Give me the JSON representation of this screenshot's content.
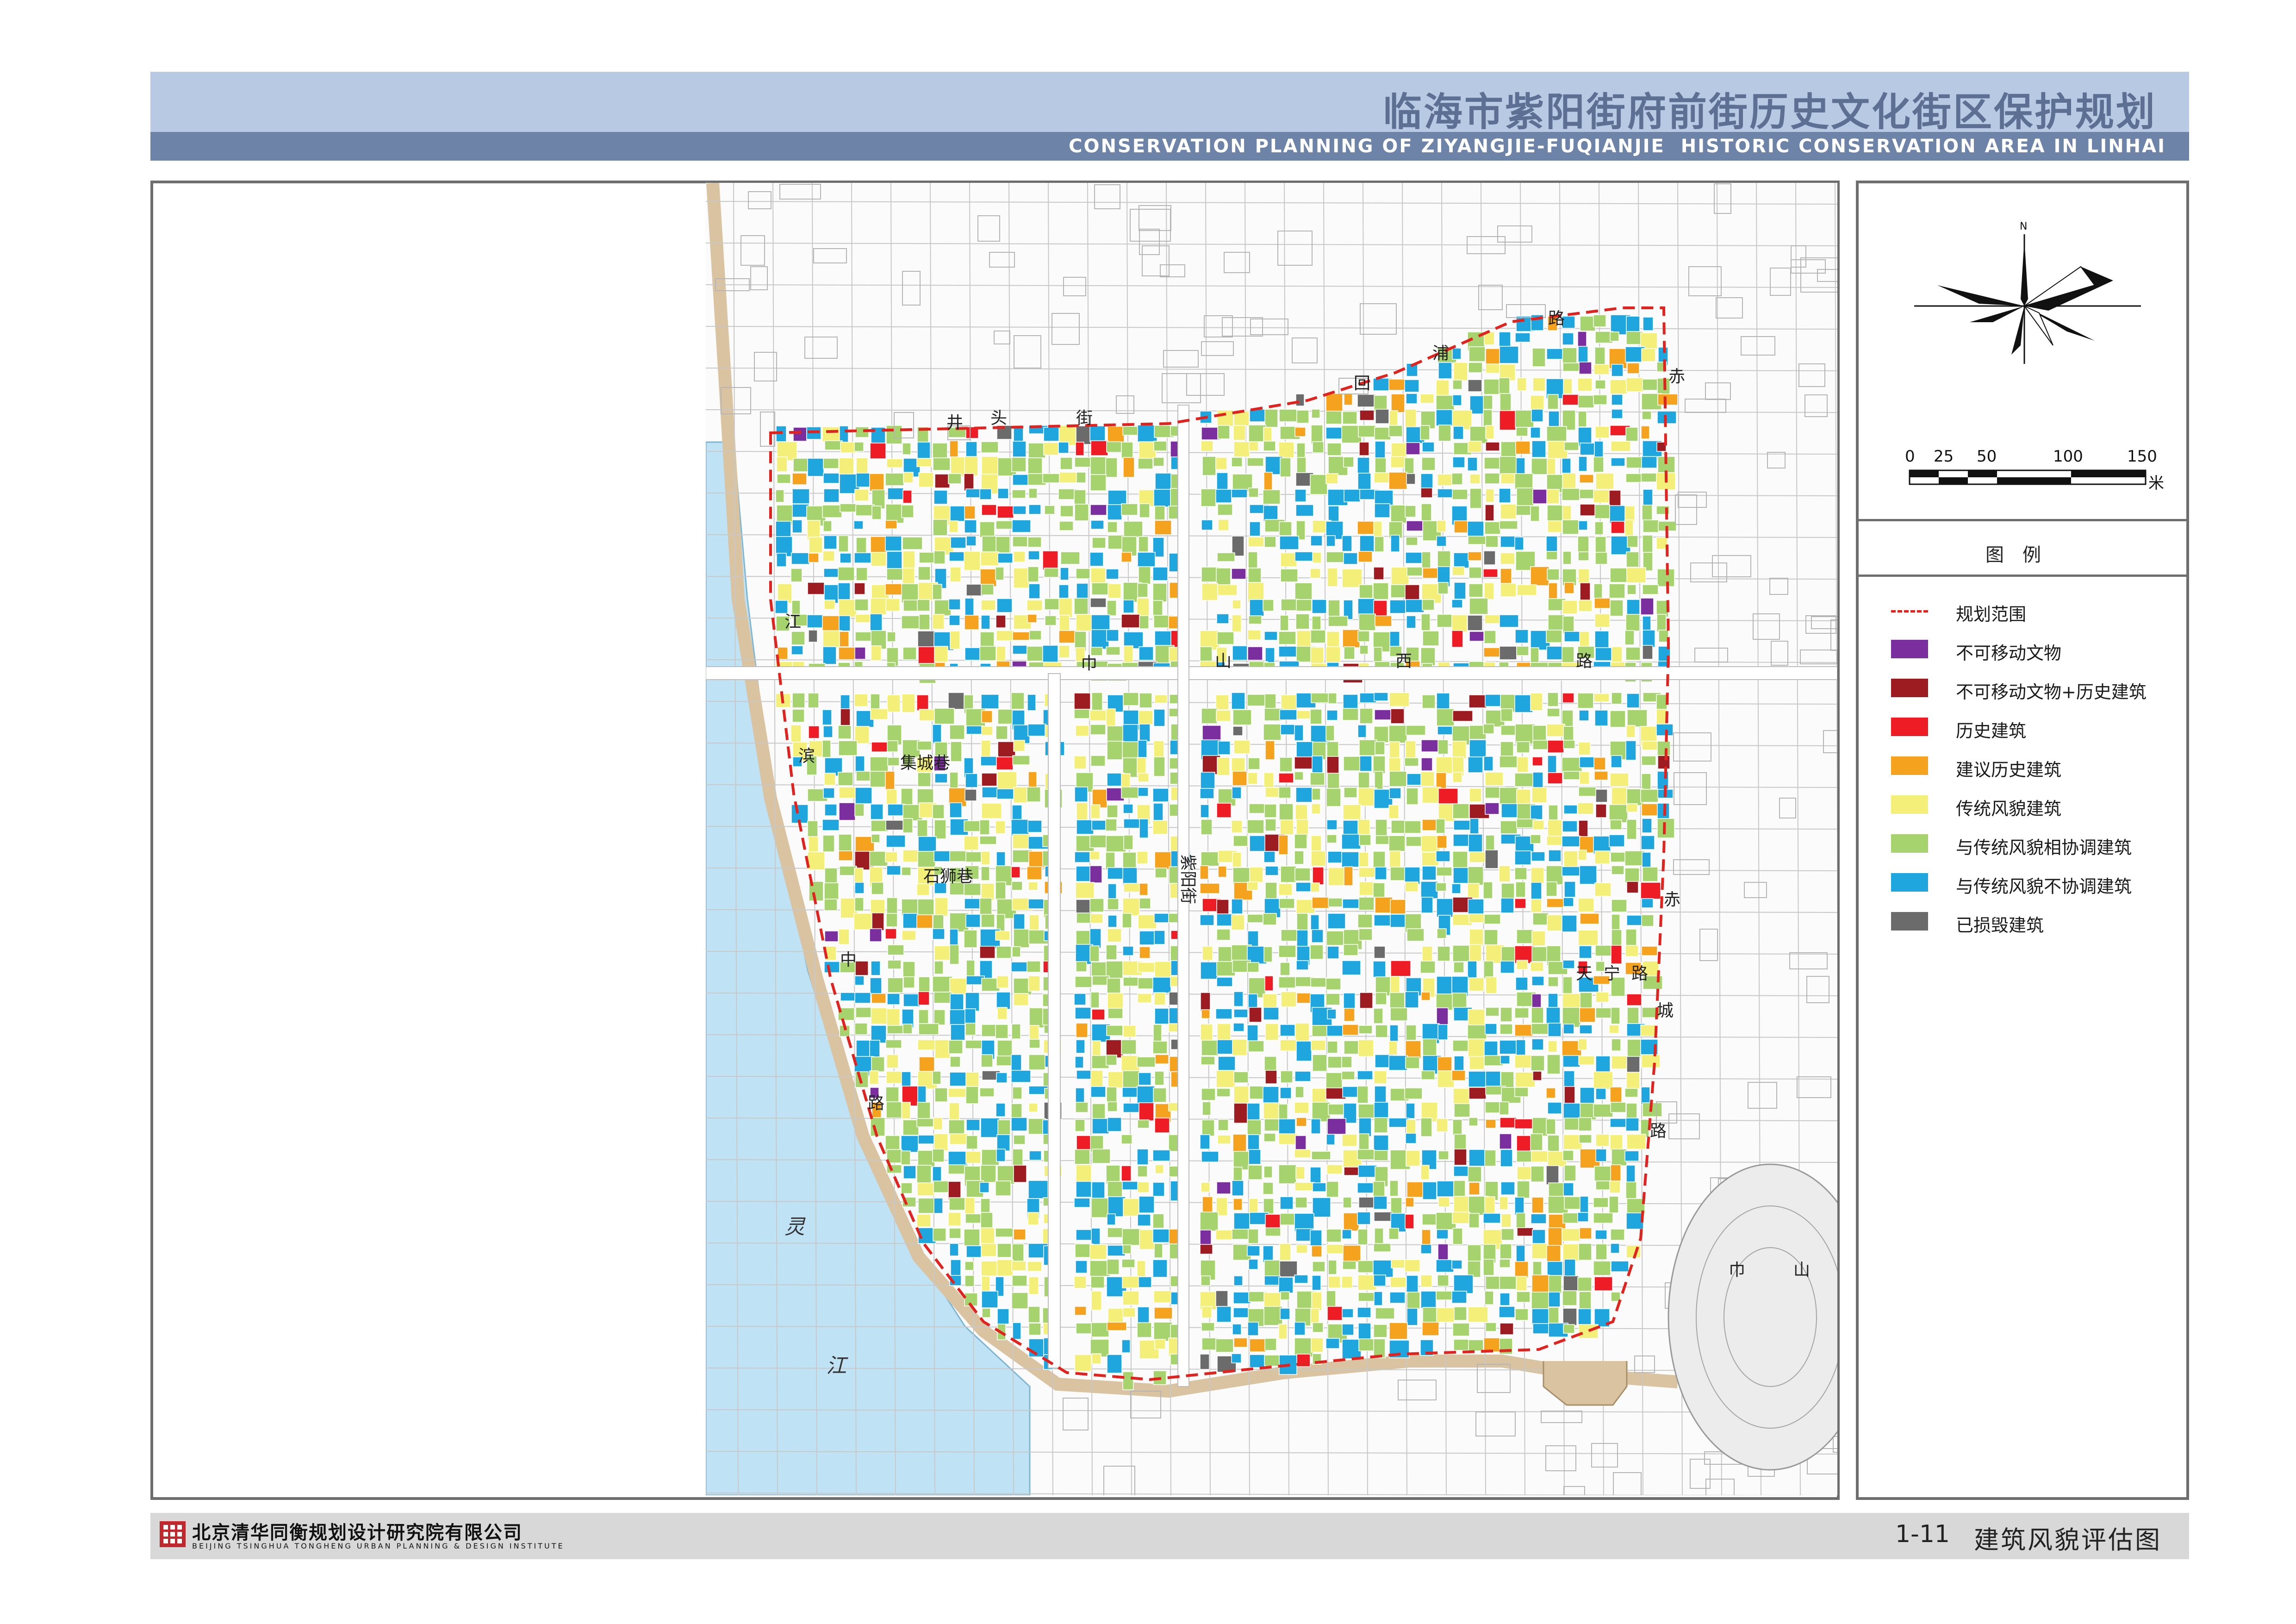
{
  "header": {
    "title": "临海市紫阳街府前街历史文化街区保护规划",
    "subtitle": "CONSERVATION PLANNING OF ZIYANGJIE-FUQIANJIE  HISTORIC CONSERVATION AREA IN LINHAI"
  },
  "scale": {
    "ticks": [
      "0",
      "25",
      "50",
      "100",
      "150"
    ],
    "unit": "米"
  },
  "compass": {
    "north_label": "N"
  },
  "legend": {
    "title": "图例",
    "items": [
      {
        "label": "规划范围",
        "color": "#e0231e",
        "style": "dashed"
      },
      {
        "label": "不可移动文物",
        "color": "#7b2e9e",
        "style": "fill"
      },
      {
        "label": "不可移动文物+历史建筑",
        "color": "#9c1c22",
        "style": "fill"
      },
      {
        "label": "历史建筑",
        "color": "#ee1c25",
        "style": "fill"
      },
      {
        "label": "建议历史建筑",
        "color": "#f5a21f",
        "style": "fill"
      },
      {
        "label": "传统风貌建筑",
        "color": "#f3ef79",
        "style": "fill"
      },
      {
        "label": "与传统风貌相协调建筑",
        "color": "#a6d36e",
        "style": "fill"
      },
      {
        "label": "与传统风貌不协调建筑",
        "color": "#1fa6df",
        "style": "fill"
      },
      {
        "label": "已损毁建筑",
        "color": "#6b6b6b",
        "style": "fill"
      }
    ]
  },
  "map_labels": {
    "river_1": "灵",
    "river_2": "江",
    "road_jiangbin_1": "江",
    "road_jiangbin_2": "滨",
    "road_jiangbin_3": "中",
    "road_jiangbin_4": "路",
    "road_jingtou_1": "井",
    "road_jingtou_2": "头",
    "road_jingtou_3": "街",
    "road_huipu_1": "回",
    "road_huipu_2": "浦",
    "road_huipu_3": "路",
    "road_zhongshan_1": "巾",
    "road_zhongshan_2": "山",
    "road_zhongshan_3": "西",
    "road_zhongshan_4": "路",
    "road_chicheng_1": "赤",
    "road_chicheng_2": "城",
    "road_chicheng_3": "路",
    "road_tianning_1": "天",
    "road_tianning_2": "宁",
    "road_tianning_3": "路",
    "mountain_1": "巾",
    "mountain_2": "山",
    "lane_jicheng": "集城巷",
    "lane_shishi": "石狮巷",
    "lane_ziyang": "紫阳街"
  },
  "footer": {
    "company_cn": "北京清华同衡规划设计研究院有限公司",
    "company_en": "BEIJING TSINGHUA TONGHENG URBAN PLANNING & DESIGN INSTITUTE",
    "sheet_number": "1-11",
    "sheet_title": "建筑风貌评估图"
  },
  "colors": {
    "header_light": "#b8c9e4",
    "header_dark": "#6d83a8",
    "river": "#bfe3f5",
    "city_wall": "#d9c3a0",
    "boundary": "#e0231e"
  }
}
